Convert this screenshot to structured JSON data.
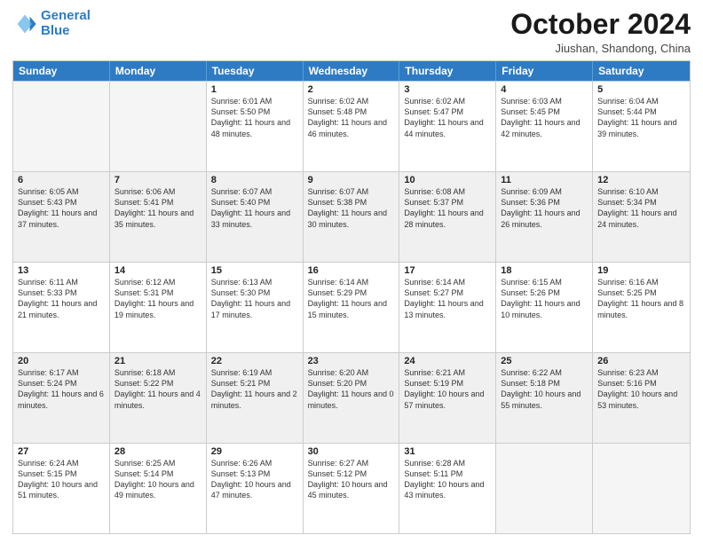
{
  "header": {
    "logo_line1": "General",
    "logo_line2": "Blue",
    "month": "October 2024",
    "location": "Jiushan, Shandong, China"
  },
  "days_of_week": [
    "Sunday",
    "Monday",
    "Tuesday",
    "Wednesday",
    "Thursday",
    "Friday",
    "Saturday"
  ],
  "rows": [
    [
      {
        "day": "",
        "text": "",
        "empty": true
      },
      {
        "day": "",
        "text": "",
        "empty": true
      },
      {
        "day": "1",
        "text": "Sunrise: 6:01 AM\nSunset: 5:50 PM\nDaylight: 11 hours and 48 minutes."
      },
      {
        "day": "2",
        "text": "Sunrise: 6:02 AM\nSunset: 5:48 PM\nDaylight: 11 hours and 46 minutes."
      },
      {
        "day": "3",
        "text": "Sunrise: 6:02 AM\nSunset: 5:47 PM\nDaylight: 11 hours and 44 minutes."
      },
      {
        "day": "4",
        "text": "Sunrise: 6:03 AM\nSunset: 5:45 PM\nDaylight: 11 hours and 42 minutes."
      },
      {
        "day": "5",
        "text": "Sunrise: 6:04 AM\nSunset: 5:44 PM\nDaylight: 11 hours and 39 minutes."
      }
    ],
    [
      {
        "day": "6",
        "text": "Sunrise: 6:05 AM\nSunset: 5:43 PM\nDaylight: 11 hours and 37 minutes."
      },
      {
        "day": "7",
        "text": "Sunrise: 6:06 AM\nSunset: 5:41 PM\nDaylight: 11 hours and 35 minutes."
      },
      {
        "day": "8",
        "text": "Sunrise: 6:07 AM\nSunset: 5:40 PM\nDaylight: 11 hours and 33 minutes."
      },
      {
        "day": "9",
        "text": "Sunrise: 6:07 AM\nSunset: 5:38 PM\nDaylight: 11 hours and 30 minutes."
      },
      {
        "day": "10",
        "text": "Sunrise: 6:08 AM\nSunset: 5:37 PM\nDaylight: 11 hours and 28 minutes."
      },
      {
        "day": "11",
        "text": "Sunrise: 6:09 AM\nSunset: 5:36 PM\nDaylight: 11 hours and 26 minutes."
      },
      {
        "day": "12",
        "text": "Sunrise: 6:10 AM\nSunset: 5:34 PM\nDaylight: 11 hours and 24 minutes."
      }
    ],
    [
      {
        "day": "13",
        "text": "Sunrise: 6:11 AM\nSunset: 5:33 PM\nDaylight: 11 hours and 21 minutes."
      },
      {
        "day": "14",
        "text": "Sunrise: 6:12 AM\nSunset: 5:31 PM\nDaylight: 11 hours and 19 minutes."
      },
      {
        "day": "15",
        "text": "Sunrise: 6:13 AM\nSunset: 5:30 PM\nDaylight: 11 hours and 17 minutes."
      },
      {
        "day": "16",
        "text": "Sunrise: 6:14 AM\nSunset: 5:29 PM\nDaylight: 11 hours and 15 minutes."
      },
      {
        "day": "17",
        "text": "Sunrise: 6:14 AM\nSunset: 5:27 PM\nDaylight: 11 hours and 13 minutes."
      },
      {
        "day": "18",
        "text": "Sunrise: 6:15 AM\nSunset: 5:26 PM\nDaylight: 11 hours and 10 minutes."
      },
      {
        "day": "19",
        "text": "Sunrise: 6:16 AM\nSunset: 5:25 PM\nDaylight: 11 hours and 8 minutes."
      }
    ],
    [
      {
        "day": "20",
        "text": "Sunrise: 6:17 AM\nSunset: 5:24 PM\nDaylight: 11 hours and 6 minutes."
      },
      {
        "day": "21",
        "text": "Sunrise: 6:18 AM\nSunset: 5:22 PM\nDaylight: 11 hours and 4 minutes."
      },
      {
        "day": "22",
        "text": "Sunrise: 6:19 AM\nSunset: 5:21 PM\nDaylight: 11 hours and 2 minutes."
      },
      {
        "day": "23",
        "text": "Sunrise: 6:20 AM\nSunset: 5:20 PM\nDaylight: 11 hours and 0 minutes."
      },
      {
        "day": "24",
        "text": "Sunrise: 6:21 AM\nSunset: 5:19 PM\nDaylight: 10 hours and 57 minutes."
      },
      {
        "day": "25",
        "text": "Sunrise: 6:22 AM\nSunset: 5:18 PM\nDaylight: 10 hours and 55 minutes."
      },
      {
        "day": "26",
        "text": "Sunrise: 6:23 AM\nSunset: 5:16 PM\nDaylight: 10 hours and 53 minutes."
      }
    ],
    [
      {
        "day": "27",
        "text": "Sunrise: 6:24 AM\nSunset: 5:15 PM\nDaylight: 10 hours and 51 minutes."
      },
      {
        "day": "28",
        "text": "Sunrise: 6:25 AM\nSunset: 5:14 PM\nDaylight: 10 hours and 49 minutes."
      },
      {
        "day": "29",
        "text": "Sunrise: 6:26 AM\nSunset: 5:13 PM\nDaylight: 10 hours and 47 minutes."
      },
      {
        "day": "30",
        "text": "Sunrise: 6:27 AM\nSunset: 5:12 PM\nDaylight: 10 hours and 45 minutes."
      },
      {
        "day": "31",
        "text": "Sunrise: 6:28 AM\nSunset: 5:11 PM\nDaylight: 10 hours and 43 minutes."
      },
      {
        "day": "",
        "text": "",
        "empty": true
      },
      {
        "day": "",
        "text": "",
        "empty": true
      }
    ]
  ]
}
